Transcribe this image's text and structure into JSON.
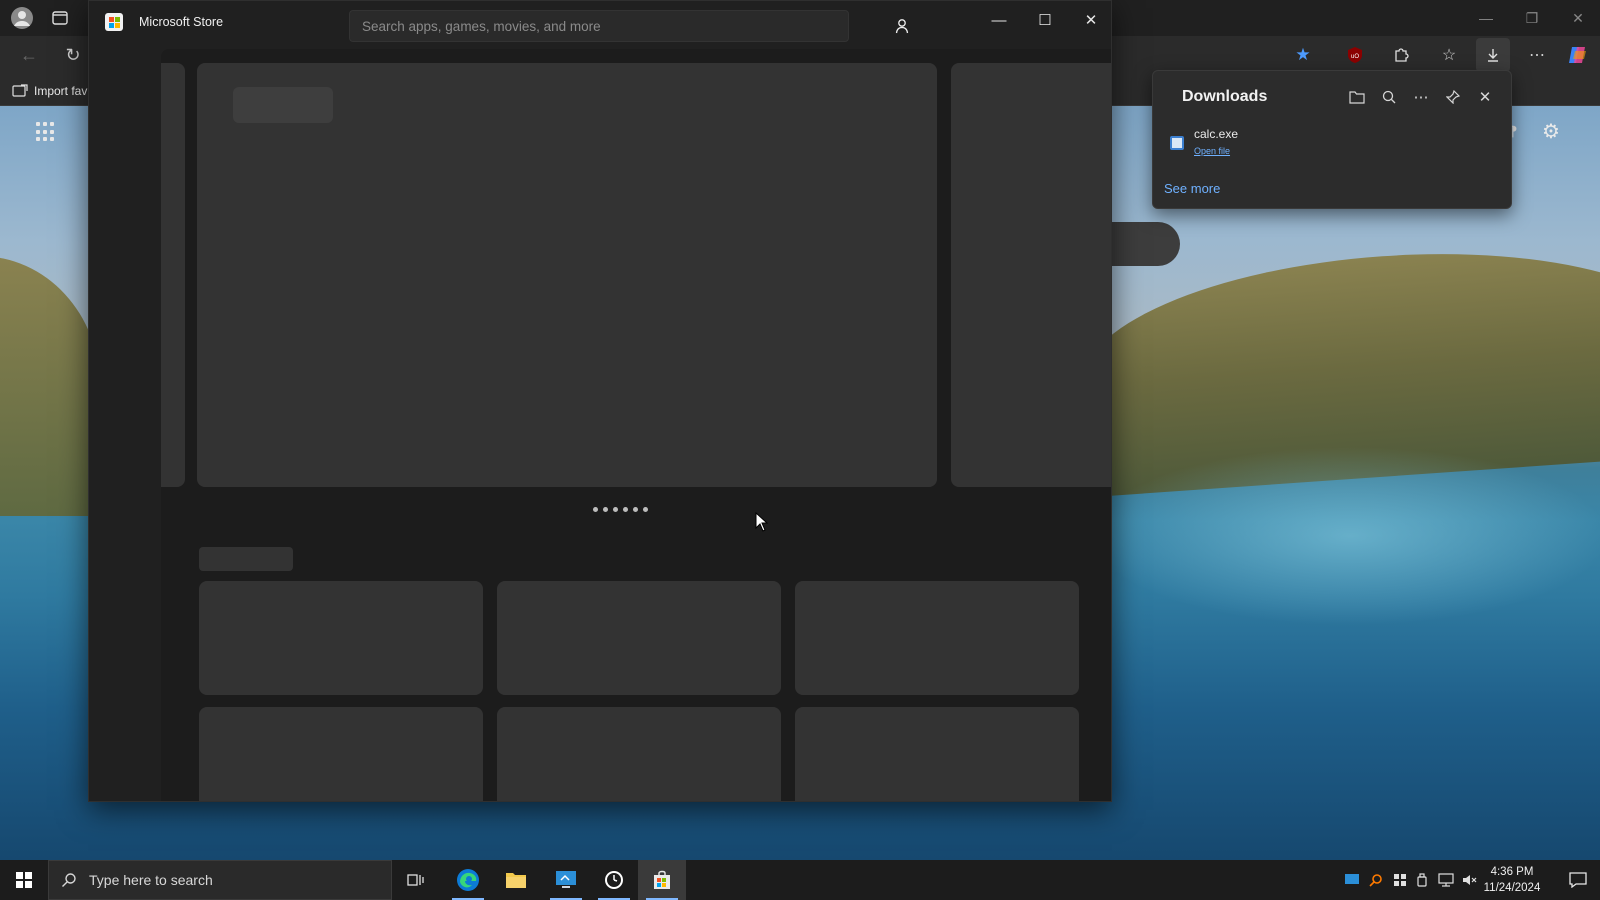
{
  "edge": {
    "favorites_bar": {
      "import_label": "Import fav"
    },
    "window_controls": [
      "minimize",
      "restore",
      "close"
    ]
  },
  "downloads": {
    "title": "Downloads",
    "items": [
      {
        "name": "calc.exe",
        "action": "Open file"
      }
    ],
    "see_more": "See more"
  },
  "store": {
    "title": "Microsoft Store",
    "search_placeholder": "Search apps, games, movies, and more",
    "carousel_dot_count": 6
  },
  "taskbar": {
    "search_placeholder": "Type here to search",
    "time": "4:36 PM",
    "date": "11/24/2024"
  }
}
